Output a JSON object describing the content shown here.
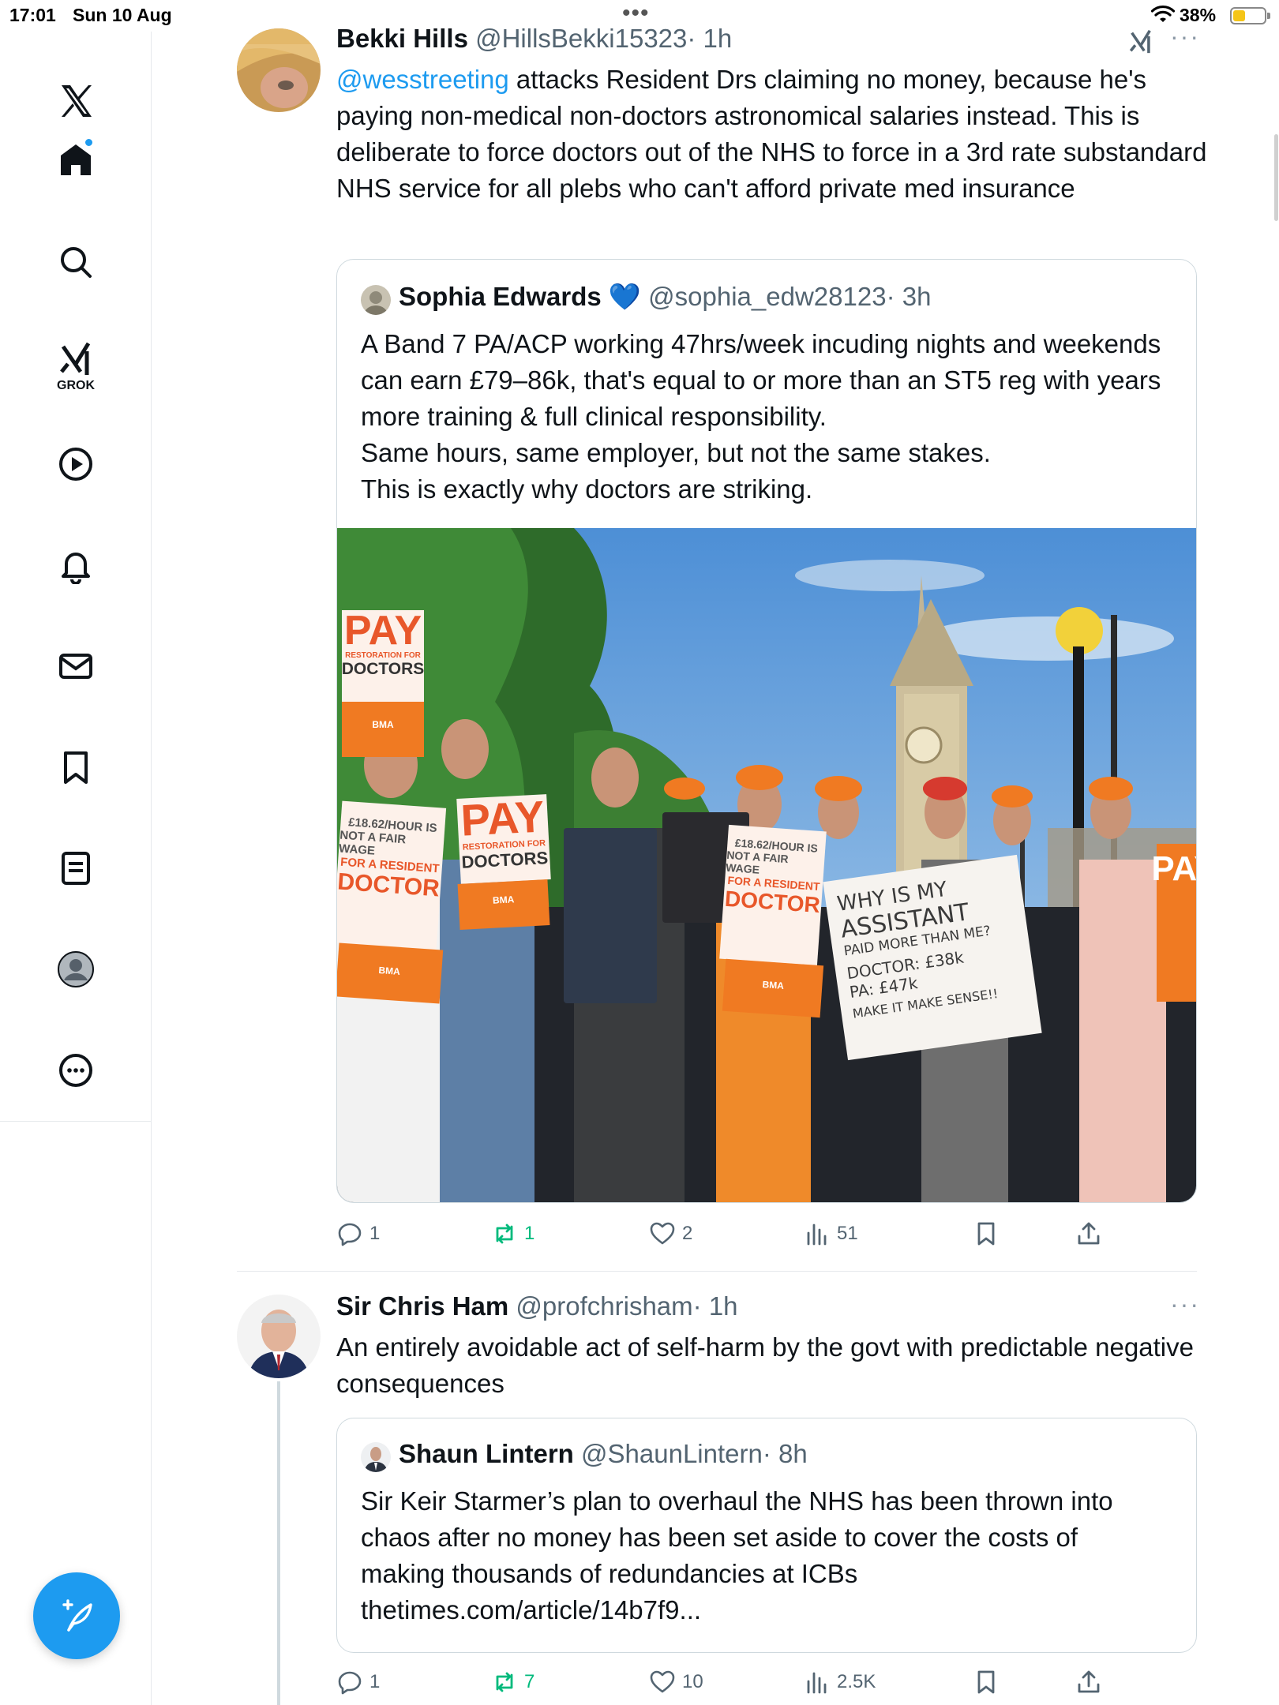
{
  "status_bar": {
    "time": "17:01",
    "date": "Sun 10 Aug",
    "battery_pct": "38%",
    "battery_level": 0.38
  },
  "sidebar": {
    "grok_label": "GROK",
    "items": [
      "home",
      "search",
      "grok",
      "video",
      "notifications",
      "messages",
      "bookmarks",
      "lists",
      "profile",
      "more"
    ]
  },
  "tweets": [
    {
      "name": "Bekki Hills",
      "handle": "@HillsBekki15323",
      "time": "· 1h",
      "mention": "@wesstreeting",
      "text": " attacks Resident Drs claiming no money, because he's paying non-medical non-doctors astronomical salaries instead. This is deliberate to force doctors out of the NHS to force in a 3rd rate substandard NHS service for all plebs who can't afford private med insurance",
      "quote": {
        "name": "Sophia Edwards",
        "verified_emoji": "💙",
        "handle": "@sophia_edw28123",
        "time": "· 3h",
        "text": "A Band 7 PA/ACP working 47hrs/week incuding nights and weekends can earn £79–86k, that's equal to or more than an ST5 reg with years more training & full clinical responsibility.\nSame hours, same employer, but not the same stakes.\nThis is exactly why doctors are striking.",
        "photo_signs": {
          "pay": "PAY",
          "restoration": "RESTORATION FOR",
          "doctors": "DOCTORS",
          "bma": "BMA",
          "wage_line1": "£18.62/HOUR IS",
          "wage_line2": "NOT A FAIR WAGE",
          "wage_line3": "FOR A RESIDENT",
          "wage_line4": "DOCTOR",
          "hand_line1": "WHY IS MY",
          "hand_line2": "ASSISTANT",
          "hand_line3": "PAID MORE THAN ME?",
          "hand_line4": "DOCTOR: £38k",
          "hand_line5": "PA: £47k",
          "hand_line6": "MAKE IT MAKE SENSE!!"
        }
      },
      "actions": {
        "replies": "1",
        "reposts": "1",
        "likes": "2",
        "views": "51"
      }
    },
    {
      "name": "Sir Chris Ham",
      "handle": "@profchrisham",
      "time": "· 1h",
      "text": "An entirely avoidable act of self-harm by the govt with predictable negative consequences",
      "quote": {
        "name": "Shaun Lintern",
        "handle": "@ShaunLintern",
        "time": "· 8h",
        "text": "Sir Keir Starmer’s plan to overhaul the NHS has been thrown into chaos after no money has been set aside to cover the costs of making thousands of redundancies at ICBs thetimes.com/article/14b7f9..."
      },
      "actions": {
        "replies": "1",
        "reposts": "7",
        "likes": "10",
        "views": "2.5K"
      }
    }
  ],
  "colors": {
    "accent": "#1d9bf0",
    "repost": "#00ba7c",
    "muted": "#536471",
    "sign_orange": "#e8572a"
  }
}
